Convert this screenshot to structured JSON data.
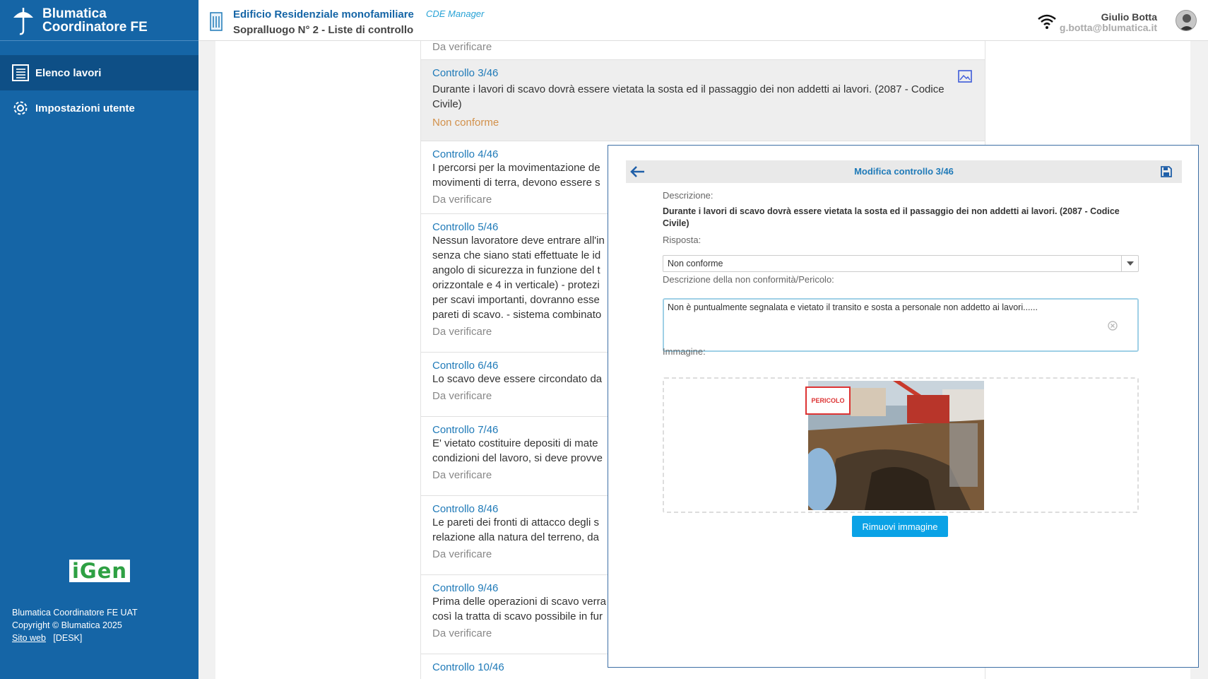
{
  "sidebar": {
    "brand_line1": "Blumatica",
    "brand_line2": "Coordinatore FE",
    "items": [
      {
        "label": "Elenco lavori",
        "icon": "list-icon",
        "active": true
      },
      {
        "label": "Impostazioni utente",
        "icon": "gear-icon",
        "active": false
      }
    ],
    "igen_logo": "iGen",
    "footer": {
      "line1": "Blumatica Coordinatore FE UAT",
      "line2": "Copyright © Blumatica 2025",
      "link": "Sito web",
      "tag": "[DESK]"
    }
  },
  "header": {
    "title": "Edificio Residenziale monofamiliare",
    "subtitle": "CDE Manager",
    "line2": "Sopralluogo N° 2 - Liste di controllo",
    "user_name": "Giulio Botta",
    "user_email": "g.botta@blumatica.it"
  },
  "controls": [
    {
      "title": "",
      "desc": [],
      "status": "Da verificare"
    },
    {
      "title": "Controllo 3/46",
      "desc": [
        "Durante i lavori di scavo dovrà essere vietata la sosta ed il passaggio dei non addetti ai lavori. (2087 - Codice",
        "Civile)"
      ],
      "status": "Non conforme"
    },
    {
      "title": "Controllo 4/46",
      "desc": [
        "I percorsi per la movimentazione de",
        "movimenti di terra, devono essere s"
      ],
      "status": "Da verificare"
    },
    {
      "title": "Controllo 5/46",
      "desc": [
        "Nessun lavoratore deve entrare all'in",
        "senza che siano stati effettuate le id",
        "angolo di sicurezza in funzione del t",
        "orizzontale e 4 in verticale) - protezi",
        "per scavi importanti, dovranno esse",
        "pareti di scavo. - sistema combinato"
      ],
      "status": "Da verificare"
    },
    {
      "title": "Controllo 6/46",
      "desc": [
        "Lo scavo deve essere circondato da"
      ],
      "status": "Da verificare"
    },
    {
      "title": "Controllo 7/46",
      "desc": [
        "E' vietato costituire depositi di mate",
        "condizioni del lavoro, si deve provve"
      ],
      "status": "Da verificare"
    },
    {
      "title": "Controllo 8/46",
      "desc": [
        "Le pareti dei fronti di attacco degli s",
        "relazione alla natura del terreno, da"
      ],
      "status": "Da verificare"
    },
    {
      "title": "Controllo 9/46",
      "desc": [
        "Prima delle operazioni di scavo verra",
        "così la tratta di scavo possibile in fur"
      ],
      "status": "Da verificare"
    },
    {
      "title": "Controllo 10/46",
      "desc": [],
      "status": ""
    }
  ],
  "modal": {
    "title": "Modifica controllo 3/46",
    "descrizione_label": "Descrizione:",
    "descrizione": "Durante i lavori di scavo dovrà essere vietata la sosta ed il passaggio dei non addetti ai lavori. (2087 - Codice Civile)",
    "risposta_label": "Risposta:",
    "risposta_value": "Non conforme",
    "nc_label": "Descrizione della non conformità/Pericolo:",
    "nc_value": "Non è puntualmente segnalata e vietato il transito e sosta a personale non addetto ai lavori......",
    "immagine_label": "Immagine:",
    "pericolo_label": "PERICOLO",
    "remove_button": "Rimuovi immagine"
  }
}
